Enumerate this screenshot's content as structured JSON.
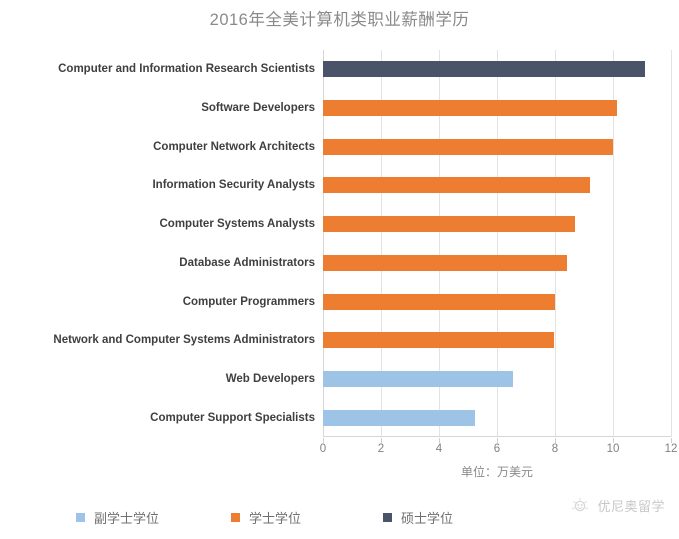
{
  "chart_data": {
    "type": "bar",
    "orientation": "horizontal",
    "title": "2016年全美计算机类职业薪酬学历",
    "xlabel": "单位：万美元",
    "ylabel": "",
    "xlim": [
      0,
      12
    ],
    "xticks": [
      "0",
      "2",
      "4",
      "6",
      "8",
      "10",
      "12"
    ],
    "grid": true,
    "legend_position": "bottom",
    "categories": [
      "Computer and Information Research Scientists",
      "Software Developers",
      "Computer Network Architects",
      "Information Security Analysts",
      "Computer Systems Analysts",
      "Database Administrators",
      "Computer Programmers",
      "Network and Computer Systems Administrators",
      "Web Developers",
      "Computer Support Specialists"
    ],
    "values": [
      11.1,
      10.15,
      10.0,
      9.2,
      8.7,
      8.4,
      8.0,
      7.95,
      6.55,
      5.25
    ],
    "degree_levels": [
      "master",
      "bachelor",
      "bachelor",
      "bachelor",
      "bachelor",
      "bachelor",
      "bachelor",
      "bachelor",
      "associate",
      "associate"
    ],
    "series": [
      {
        "name": "副学士学位",
        "key": "associate",
        "color": "#9DC3E6",
        "values": [
          null,
          null,
          null,
          null,
          null,
          null,
          null,
          null,
          6.55,
          5.25
        ]
      },
      {
        "name": "学士学位",
        "key": "bachelor",
        "color": "#ED7D31",
        "values": [
          null,
          10.15,
          10.0,
          9.2,
          8.7,
          8.4,
          8.0,
          7.95,
          null,
          null
        ]
      },
      {
        "name": "硕士学位",
        "key": "master",
        "color": "#4A5468",
        "values": [
          11.1,
          null,
          null,
          null,
          null,
          null,
          null,
          null,
          null,
          null
        ]
      }
    ]
  },
  "legend": [
    {
      "label": "副学士学位",
      "color": "#9DC3E6"
    },
    {
      "label": "学士学位",
      "color": "#ED7D31"
    },
    {
      "label": "硕士学位",
      "color": "#4A5468"
    }
  ],
  "watermark": {
    "text": "优尼奥留学",
    "icon": "sun-sparkle-logo-icon"
  },
  "colors": {
    "associate": "#9DC3E6",
    "bachelor": "#ED7D31",
    "master": "#4A5468",
    "grid": "#E3E3E3",
    "title_text": "#8A8A8A",
    "category_text": "#3F3F3F",
    "tick_text": "#808080",
    "background": "#FFFFFF"
  }
}
